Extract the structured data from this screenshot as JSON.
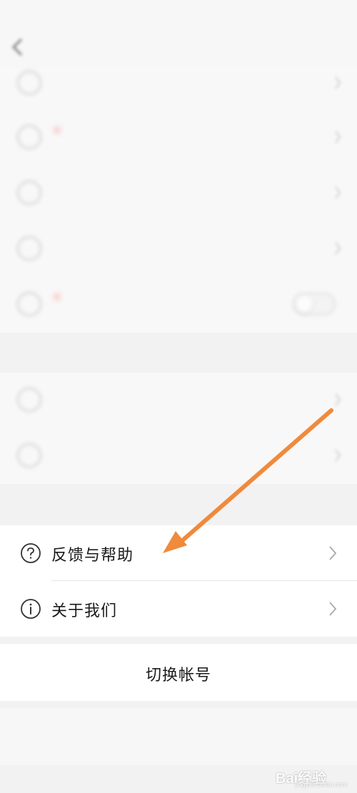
{
  "arrow_color": "#f08a3c",
  "status_bar": {
    "left_text": "",
    "right_text": ""
  },
  "nav": {
    "title": ""
  },
  "blurred_rows": [
    {
      "label": "",
      "value": ""
    },
    {
      "label": "",
      "value": ""
    },
    {
      "label": "",
      "value": ""
    },
    {
      "label": "",
      "value": ""
    },
    {
      "label": "",
      "value": ""
    }
  ],
  "blurred_section_2": [
    {
      "label": "",
      "value": ""
    },
    {
      "label": "",
      "value": ""
    }
  ],
  "about_section": {
    "feedback_label": "反馈与帮助",
    "about_label": "关于我们"
  },
  "switch_account_label": "切换帐号",
  "logout_label": "",
  "watermark": {
    "text": "Bai经验",
    "sub": "jingyan.baidu.com"
  }
}
